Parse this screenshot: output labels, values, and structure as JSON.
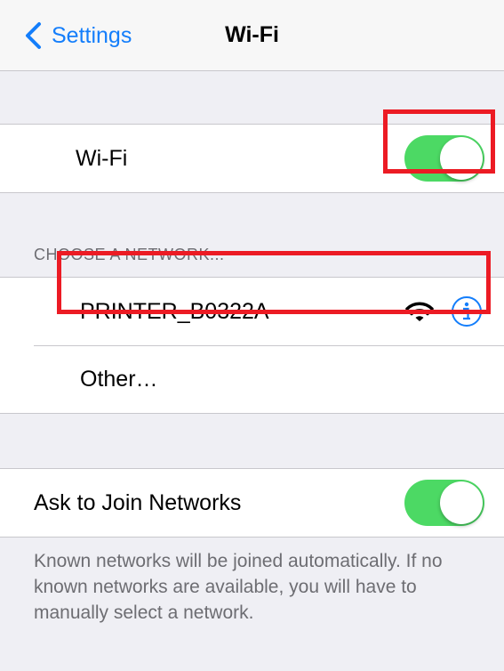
{
  "navbar": {
    "back_label": "Settings",
    "title": "Wi-Fi"
  },
  "wifi_group": {
    "label": "Wi-Fi",
    "toggle_on": true
  },
  "networks": {
    "header": "CHOOSE A NETWORK...",
    "items": [
      {
        "label": "PRINTER_B0322A",
        "icons": [
          "wifi-signal-icon",
          "info-icon"
        ]
      },
      {
        "label": "Other…"
      }
    ]
  },
  "ask_join": {
    "label": "Ask to Join Networks",
    "toggle_on": true,
    "footer": "Known networks will be joined automatically. If no known networks are available, you will have to manually select a network."
  },
  "colors": {
    "accent": "#147efb",
    "toggle_on": "#4cd964",
    "background": "#efeff4",
    "highlight": "#ec1b24"
  }
}
